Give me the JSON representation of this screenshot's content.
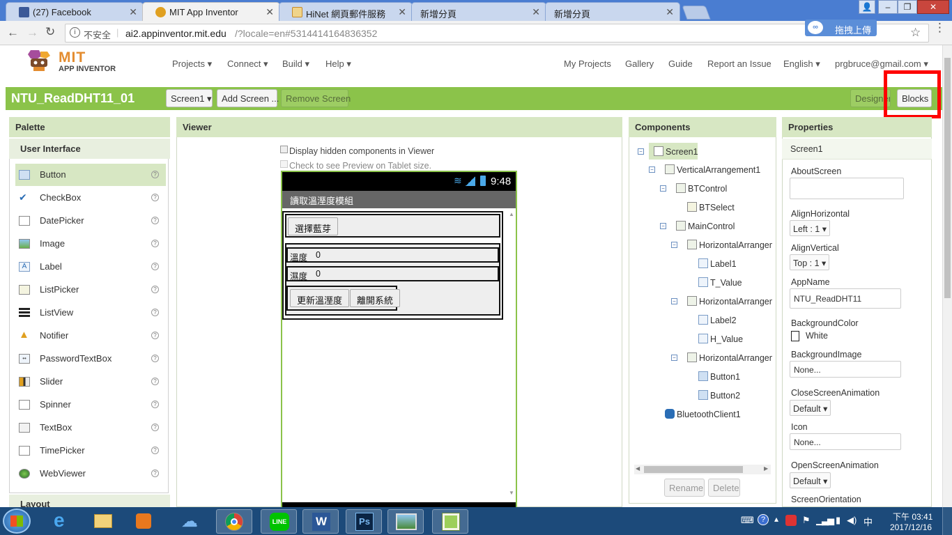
{
  "browser": {
    "tabs": [
      {
        "title": "(27) Facebook"
      },
      {
        "title": "MIT App Inventor"
      },
      {
        "title": "HiNet 網頁郵件服務"
      },
      {
        "title": "新增分頁"
      },
      {
        "title": "新增分頁"
      }
    ],
    "security_label": "不安全",
    "url_host": "ai2.appinventor.mit.edu",
    "url_rest": "/?locale=en#5314414164836352",
    "upload_button": "拖拽上傳"
  },
  "app": {
    "logo_line1": "MIT",
    "logo_line2": "APP INVENTOR",
    "menus": [
      "Projects",
      "Connect",
      "Build",
      "Help"
    ],
    "links": [
      "My Projects",
      "Gallery",
      "Guide",
      "Report an Issue",
      "English",
      "prgbruce@gmail.com"
    ],
    "project_name": "NTU_ReadDHT11_01",
    "screen_select": "Screen1",
    "add_screen": "Add Screen ...",
    "remove_screen": "Remove Screen",
    "designer": "Designer",
    "blocks": "Blocks"
  },
  "palette": {
    "title": "Palette",
    "category": "User Interface",
    "items": [
      "Button",
      "CheckBox",
      "DatePicker",
      "Image",
      "Label",
      "ListPicker",
      "ListView",
      "Notifier",
      "PasswordTextBox",
      "Slider",
      "Spinner",
      "TextBox",
      "TimePicker",
      "WebViewer"
    ],
    "next_category": "Layout",
    "help_mark": "?"
  },
  "viewer": {
    "title": "Viewer",
    "hidden_check": "Display hidden components in Viewer",
    "tablet_check": "Check to see Preview on Tablet size.",
    "status_time": "9:48",
    "app_title": "讀取溫溼度模組",
    "btn_select": "選擇藍芽",
    "temp_label": "溫度",
    "temp_value": "0",
    "hum_label": "濕度",
    "hum_value": "0",
    "btn_update": "更新溫溼度",
    "btn_exit": "離開系統"
  },
  "components": {
    "title": "Components",
    "tree": [
      "Screen1",
      "VerticalArrangement1",
      "BTControl",
      "BTSelect",
      "MainControl",
      "HorizontalArrangement1",
      "Label1",
      "T_Value",
      "HorizontalArrangement2",
      "Label2",
      "H_Value",
      "HorizontalArrangement3",
      "Button1",
      "Button2",
      "BluetoothClient1"
    ],
    "rename": "Rename",
    "delete": "Delete"
  },
  "properties": {
    "title": "Properties",
    "component": "Screen1",
    "about_label": "AboutScreen",
    "align_h_label": "AlignHorizontal",
    "align_h_value": "Left : 1",
    "align_v_label": "AlignVertical",
    "align_v_value": "Top : 1",
    "appname_label": "AppName",
    "appname_value": "NTU_ReadDHT11",
    "bgcolor_label": "BackgroundColor",
    "bgcolor_value": "White",
    "bgimage_label": "BackgroundImage",
    "bgimage_value": "None...",
    "close_anim_label": "CloseScreenAnimation",
    "close_anim_value": "Default",
    "icon_label": "Icon",
    "icon_value": "None...",
    "open_anim_label": "OpenScreenAnimation",
    "open_anim_value": "Default",
    "orientation_label": "ScreenOrientation"
  },
  "taskbar": {
    "time": "下午 03:41",
    "date": "2017/12/16"
  },
  "colors": {
    "accent_green": "#8bc34a",
    "panel_header": "#d7e7c3",
    "highlight_box": "#ff0000"
  }
}
